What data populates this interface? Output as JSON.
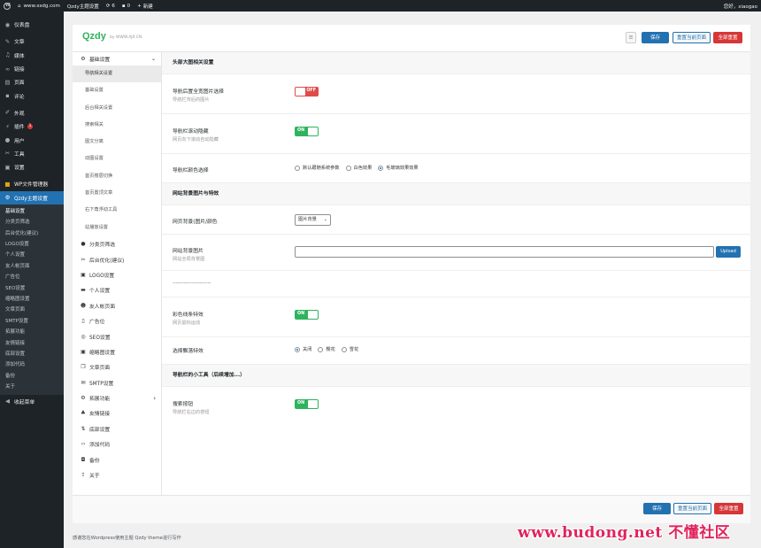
{
  "adminbar": {
    "site_url": "www.xsdg.com",
    "theme_settings": "Qzdy主题设置",
    "updates": "6",
    "comments": "0",
    "new": "新建",
    "greeting": "您好，xiaogao"
  },
  "sidebar": {
    "dashboard": "仪表盘",
    "posts": "文章",
    "media": "媒体",
    "links": "链接",
    "pages": "页面",
    "comments": "评论",
    "appearance": "外观",
    "plugins": "插件",
    "plugins_badge": "1",
    "users": "用户",
    "tools": "工具",
    "settings": "设置",
    "wp_file_manager": "WP文件管理器",
    "qzdy_settings": "Qzdy主题设置",
    "sub": [
      "基础设置",
      "分类页筛选",
      "后台优化(建议)",
      "LOGO设置",
      "个人设置",
      "友人帐页面",
      "广告位",
      "SEO设置",
      "缩略图设置",
      "文章页面",
      "SMTP设置",
      "拓展功能",
      "友情链接",
      "底部设置",
      "添加代码",
      "备份",
      "关于"
    ],
    "collapse": "收起菜单"
  },
  "panel": {
    "logo": "Qzdy",
    "logo_sub": "by WWW.AJ0.CN",
    "save": "保存",
    "reset_page": "重置当前页面",
    "reset_all": "全部重置"
  },
  "nav": {
    "group": "基础设置",
    "group_subs": [
      "导航相关设置",
      "基础设置",
      "后台相关设置",
      "搜索相关",
      "图文分离",
      "动图设置",
      "首页楼层切换",
      "首页置顶文章",
      "右下角浮动工具",
      "站播放设置"
    ],
    "items": [
      "分类页筛选",
      "后台优化(建议)",
      "LOGO设置",
      "个人设置",
      "友人帐页面",
      "广告位",
      "SEO设置",
      "缩略图设置",
      "文章页面",
      "SMTP设置",
      "拓展功能",
      "友情链接",
      "底部设置",
      "添加代码",
      "备份",
      "关于"
    ]
  },
  "content": {
    "sec1": "头部大图相关设置",
    "row1_label": "导航后置全宽图片选择",
    "row1_desc": "导航栏背后的图片",
    "row1_toggle": "OFF",
    "row2_label": "导航栏滚动隐藏",
    "row2_desc": "网页向下滚动自动隐藏",
    "row2_toggle": "ON",
    "row3_label": "导航栏颜色选择",
    "row3_options": [
      "默认跟随系统参数",
      "白色效果",
      "毛玻璃效果效果"
    ],
    "sec2": "网站背景图片与特效",
    "row4_label": "网页背景(图片/颜色",
    "row4_select": "图片背景",
    "row5_label": "网站背景图片",
    "row5_desc": "网站全局背景图",
    "row5_upload": "Upload",
    "divider": "------------------------",
    "row6_label": "彩色线条特效",
    "row6_desc": "网页鼠标运动",
    "row6_toggle": "ON",
    "row7_label": "选择飘落特效",
    "row7_options": [
      "关闭",
      "樱花",
      "雪花"
    ],
    "sec3": "导航栏的小工具（后续增加...）",
    "row8_label": "搜索按钮",
    "row8_desc": "导航栏右边的按钮",
    "row8_toggle": "ON"
  },
  "footer": "感谢您在Wordpress使用主题 Qzdy theme进行写作",
  "watermark": "www.budong.net 不懂社区",
  "colors": {
    "admin_dark": "#1d2327",
    "wp_blue": "#2271b1",
    "toggle_on": "#2fb35d",
    "toggle_off": "#e04b4a",
    "danger": "#d63638",
    "watermark": "#e0245e"
  }
}
